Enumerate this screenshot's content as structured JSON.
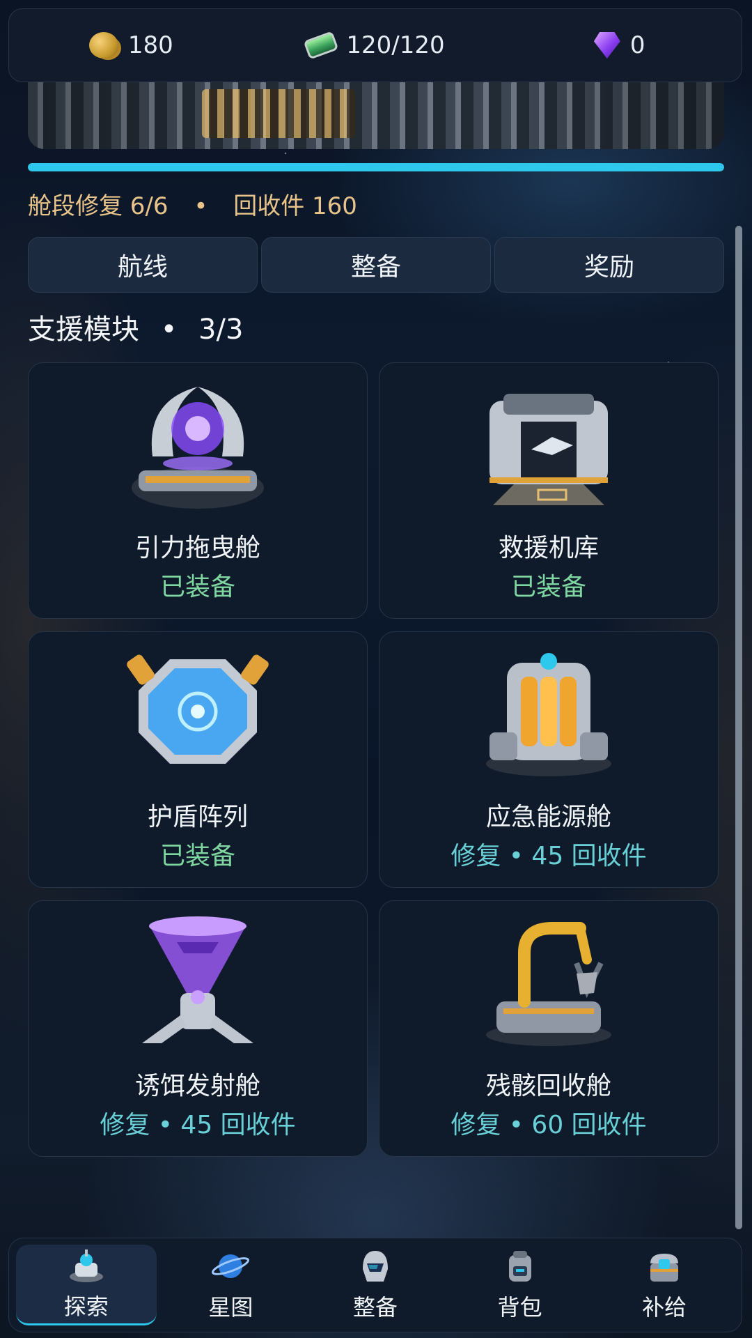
{
  "resources": [
    {
      "icon": "gold-coin-icon",
      "value": "180"
    },
    {
      "icon": "energy-battery-icon",
      "value": "120/120"
    },
    {
      "icon": "purple-gem-icon",
      "value": "0"
    }
  ],
  "progress": {
    "fraction": 1.0,
    "color": "#2ec8ec"
  },
  "status": {
    "repair": "舱段修复 6/6",
    "separator": "•",
    "salvage": "回收件 160"
  },
  "tabs": [
    {
      "label": "航线"
    },
    {
      "label": "整备"
    },
    {
      "label": "奖励"
    }
  ],
  "section": {
    "title": "支援模块",
    "separator": "•",
    "count": "3/3"
  },
  "modules": [
    {
      "name": "引力拖曳舱",
      "state": "已装备",
      "kind": "equipped",
      "icon": "gravity-tow-pod-icon"
    },
    {
      "name": "救援机库",
      "state": "已装备",
      "kind": "equipped",
      "icon": "rescue-hangar-icon"
    },
    {
      "name": "护盾阵列",
      "state": "已装备",
      "kind": "equipped",
      "icon": "shield-array-icon"
    },
    {
      "name": "应急能源舱",
      "state": "修复 • 45 回收件",
      "kind": "repair",
      "icon": "emergency-power-pod-icon"
    },
    {
      "name": "诱饵发射舱",
      "state": "修复 • 45 回收件",
      "kind": "repair",
      "icon": "decoy-launcher-pod-icon"
    },
    {
      "name": "残骸回收舱",
      "state": "修复 • 60 回收件",
      "kind": "repair",
      "icon": "wreck-salvage-pod-icon"
    }
  ],
  "nav": [
    {
      "label": "探索",
      "icon": "explore-base-icon",
      "active": true
    },
    {
      "label": "星图",
      "icon": "planet-map-icon",
      "active": false
    },
    {
      "label": "整备",
      "icon": "helmet-icon",
      "active": false
    },
    {
      "label": "背包",
      "icon": "backpack-icon",
      "active": false
    },
    {
      "label": "补给",
      "icon": "supply-chest-icon",
      "active": false
    }
  ],
  "colors": {
    "accent": "#2ec8ec",
    "equipped": "#7fd6a0",
    "repair": "#68d0d6",
    "status": "#e9c48a"
  }
}
